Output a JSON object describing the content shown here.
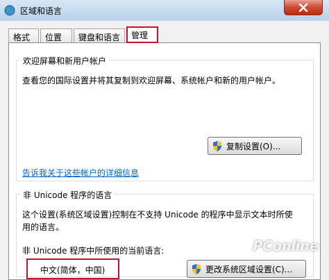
{
  "window": {
    "title": "区域和语言",
    "close_icon": "close-icon",
    "app_icon": "globe-icon"
  },
  "tabs": [
    {
      "label": "格式",
      "active": false
    },
    {
      "label": "位置",
      "active": false
    },
    {
      "label": "键盘和语言",
      "active": false
    },
    {
      "label": "管理",
      "active": true
    }
  ],
  "welcome_group": {
    "title": "欢迎屏幕和新用户帐户",
    "description": "查看您的国际设置并将其复制到欢迎屏幕、系统帐户和新的用户帐户。",
    "copy_button_label": "复制设置(O)...",
    "info_link": "告诉我关于这些帐户的详细信息"
  },
  "unicode_group": {
    "title": "非 Unicode 程序的语言",
    "description_line1": "这个设置(系统区域设置)控制在不支持 Unicode 的程序中显示文本时所使",
    "description_line2": "用的语言。",
    "current_label": "非 Unicode 程序中所使用的当前语言:",
    "current_value": "中文(简体，中国)",
    "change_button_label": "更改系统区域设置(C)..."
  },
  "watermark": "PConline",
  "colors": {
    "accent_red": "#c8102e",
    "link_blue": "#0066cc",
    "titlebar": "#c6daf0"
  }
}
